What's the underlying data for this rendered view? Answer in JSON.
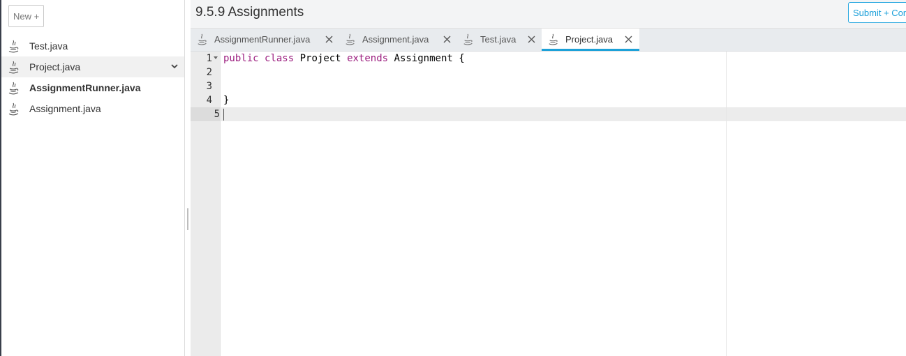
{
  "sidebar": {
    "new_button_label": "New +",
    "files": [
      {
        "label": "Test.java",
        "icon": "java-file-icon",
        "active": false,
        "bold": false
      },
      {
        "label": "Project.java",
        "icon": "java-file-icon",
        "active": true,
        "bold": false
      },
      {
        "label": "AssignmentRunner.java",
        "icon": "java-file-icon",
        "active": false,
        "bold": true
      },
      {
        "label": "Assignment.java",
        "icon": "java-file-icon",
        "active": false,
        "bold": false
      }
    ]
  },
  "header": {
    "title": "9.5.9 Assignments",
    "submit_label": "Submit + Continue"
  },
  "tabs": [
    {
      "label": "AssignmentRunner.java",
      "active": false
    },
    {
      "label": "Assignment.java",
      "active": false
    },
    {
      "label": "Test.java",
      "active": false
    },
    {
      "label": "Project.java",
      "active": true
    }
  ],
  "editor": {
    "line_numbers": [
      "1",
      "2",
      "3",
      "4",
      "5"
    ],
    "active_line": "5",
    "code": {
      "line1": {
        "kw1": "public",
        "kw2": "class",
        "name": "Project",
        "kw3": "extends",
        "parent": "Assignment",
        "brace": "{"
      },
      "line4": "}"
    }
  },
  "colors": {
    "accent": "#1da1d8",
    "keyword": "#9b1c7e",
    "gutter_bg": "#ebebeb",
    "tabbar_bg": "#e8ebee"
  }
}
